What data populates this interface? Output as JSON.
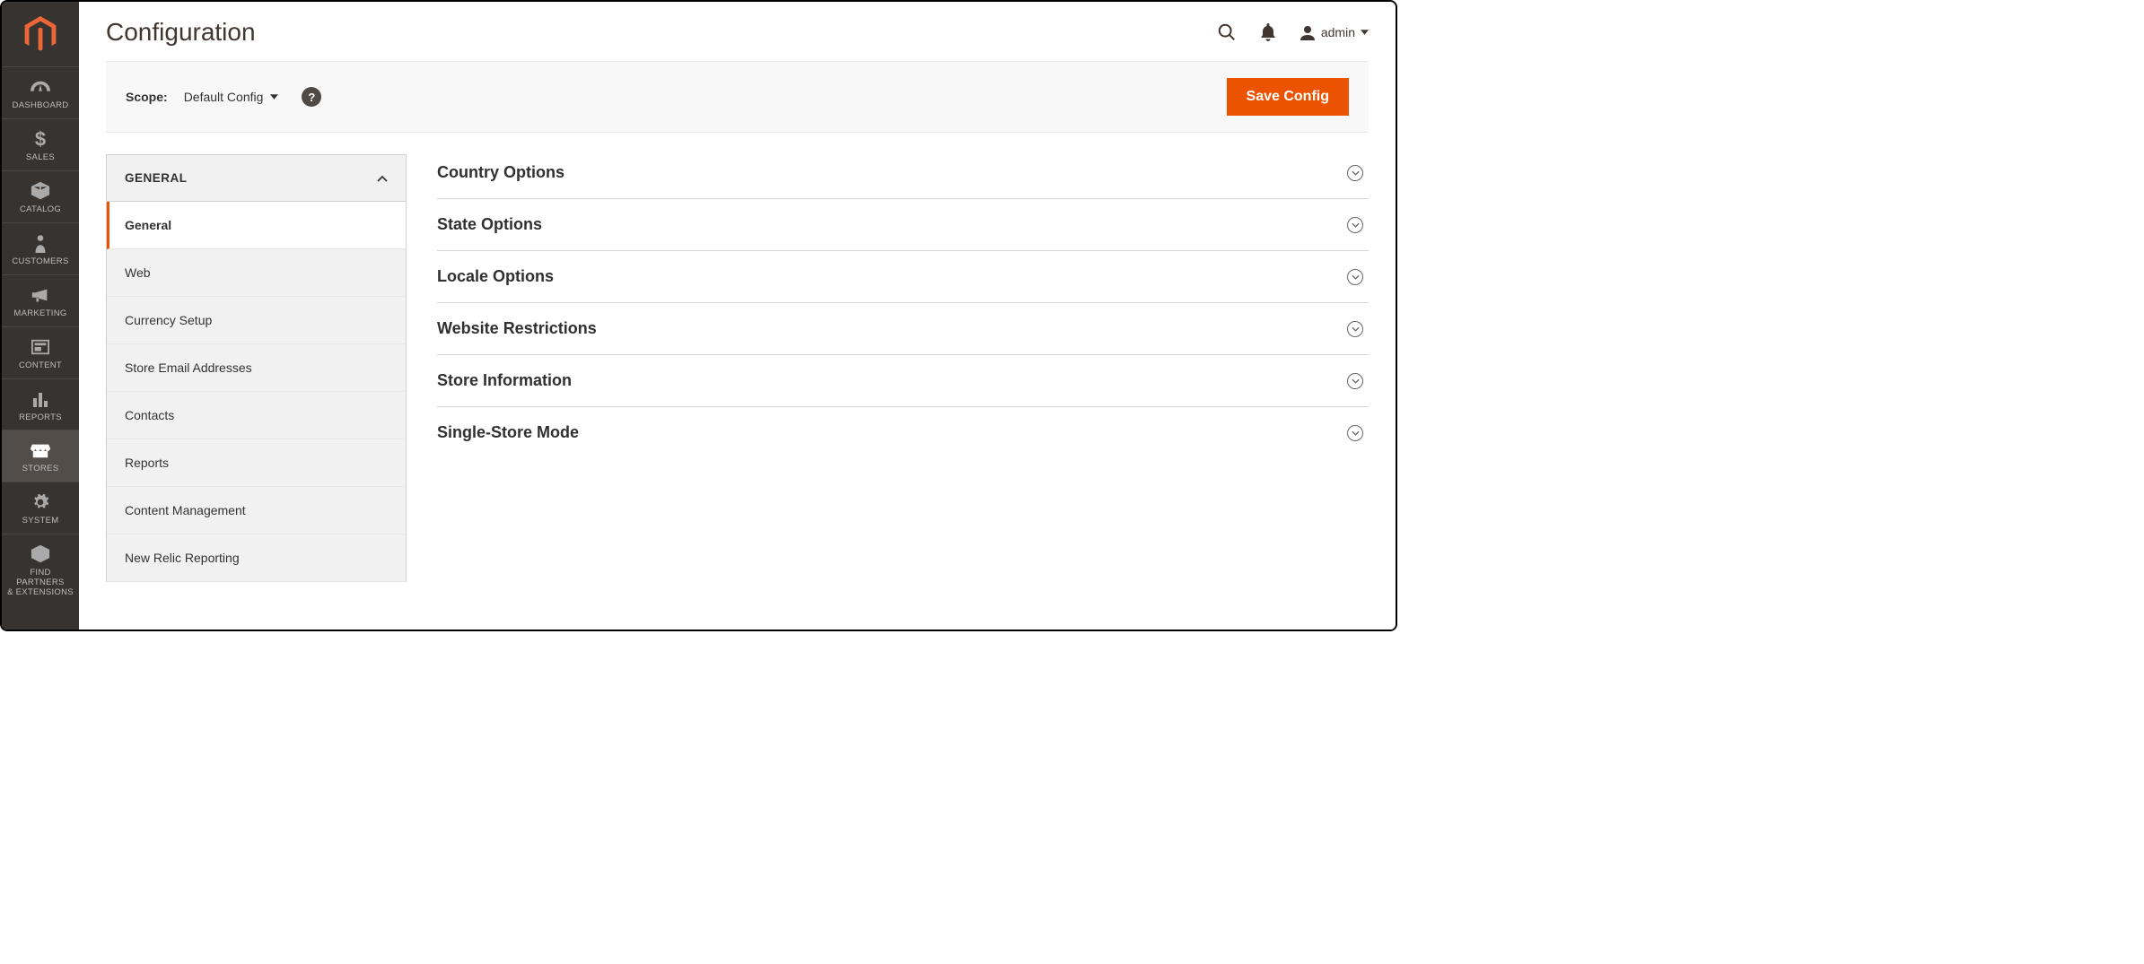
{
  "header": {
    "page_title": "Configuration",
    "user_label": "admin"
  },
  "scope": {
    "label": "Scope:",
    "value": "Default Config",
    "save_label": "Save Config"
  },
  "sidebar": {
    "items": [
      {
        "id": "dashboard",
        "label": "DASHBOARD"
      },
      {
        "id": "sales",
        "label": "SALES"
      },
      {
        "id": "catalog",
        "label": "CATALOG"
      },
      {
        "id": "customers",
        "label": "CUSTOMERS"
      },
      {
        "id": "marketing",
        "label": "MARKETING"
      },
      {
        "id": "content",
        "label": "CONTENT"
      },
      {
        "id": "reports",
        "label": "REPORTS"
      },
      {
        "id": "stores",
        "label": "STORES"
      },
      {
        "id": "system",
        "label": "SYSTEM"
      },
      {
        "id": "partners",
        "label": "FIND PARTNERS\n& EXTENSIONS"
      }
    ]
  },
  "settings_panel": {
    "group_label": "GENERAL",
    "items": [
      {
        "label": "General",
        "active": true
      },
      {
        "label": "Web"
      },
      {
        "label": "Currency Setup"
      },
      {
        "label": "Store Email Addresses"
      },
      {
        "label": "Contacts"
      },
      {
        "label": "Reports"
      },
      {
        "label": "Content Management"
      },
      {
        "label": "New Relic Reporting"
      }
    ]
  },
  "sections": [
    {
      "title": "Country Options"
    },
    {
      "title": "State Options"
    },
    {
      "title": "Locale Options"
    },
    {
      "title": "Website Restrictions"
    },
    {
      "title": "Store Information"
    },
    {
      "title": "Single-Store Mode"
    }
  ],
  "colors": {
    "accent": "#eb5202",
    "sidebar_bg": "#373330"
  }
}
